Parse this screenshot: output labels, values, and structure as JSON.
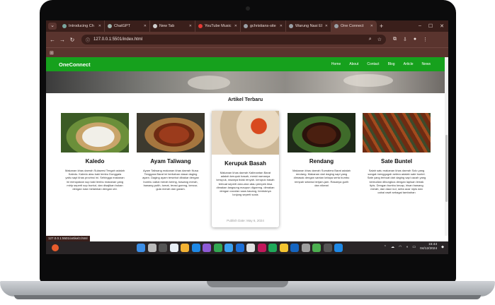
{
  "browser": {
    "tabs": [
      {
        "title": "Introducing Ch",
        "active": false,
        "favicon_color": "#7aa7a0"
      },
      {
        "title": "ChatGPT",
        "active": false,
        "favicon_color": "#9fb3ad"
      },
      {
        "title": "New Tab",
        "active": false,
        "favicon_color": "#cfcfcf"
      },
      {
        "title": "YouTube Music",
        "active": false,
        "favicon_color": "#e53935"
      },
      {
        "title": "gchristians-site",
        "active": false,
        "favicon_color": "#9aa0a6"
      },
      {
        "title": "Warung Nasi El",
        "active": false,
        "favicon_color": "#9aa0a6"
      },
      {
        "title": "One Connect",
        "active": true,
        "favicon_color": "#9aa0a6"
      }
    ],
    "url": "127.0.0.1:5501/index.html",
    "status_url": "127.0.0.1:5501/artikel3.html"
  },
  "site": {
    "brand": "OneConnect",
    "menu": [
      "Home",
      "About",
      "Contact",
      "Blog",
      "Article",
      "News"
    ],
    "section_title": "Artikel Terbaru",
    "cards": [
      {
        "title": "Kaledo",
        "text": "Makanan khas daerah Sulawesi Tengah adalah Kaledo. Kaledo atau kaki lembu Donggala yaitu sapi khas provinsi ini. Sehingga makanan ini merupakan sup kaki lembu makanan yang mirip seperti sop buntut, dan disajikan bukan dengan nasi melainkan dengan ubi."
      },
      {
        "title": "Ayam Taliwang",
        "text": "Ayam Taliwang makanan khas daerah Nusa Tenggara Barat ini berbahan dasar daging ayam. Daging ayam tersebut dibakar dengan bumbu cabai merah kering, bawang merah, bawang putih, tomat, terasi goreng, kencur, gula merah dan garam."
      },
      {
        "title": "Kerupuk Basah",
        "text": "Makanan khas daerah Kalimantan Barat adalah kerupuk basah, meski namanya kerupuk, rasanya tidak renyah. kerupuk basah terbuat seperti olan-olan atau pempek bisa dimakan langsung maupun digoreng. dimakan dengan cocolan saus kacang, bentuknya lonjong seperti sosis",
        "date": "Publish Date: May 6, 2024"
      },
      {
        "title": "Rendang",
        "text": "Makanan khas daerah Sumatera Barat adalah rendang. Makanan dari daging sapi yang dimasak dengan santan kelapa serta bumbu rempah selama berjam-jam. Rasanya gurih dan nikmat"
      },
      {
        "title": "Sate Buntel",
        "text": "Salah satu makanan khas daerah Solo yang sangat menggugah selera adalah sate buntel. Sate yang terbuat dari daging sapi cacah yang kemudian dibungkus dengan lapisan lemak tipis. Dengan bumbu kecap, irisan bawang merah, dan daun kol, serta acar nipis dan cabai rawit sebagai tambahan"
      }
    ]
  },
  "taskbar": {
    "time": "15:44",
    "date": "04/12/2024",
    "icon_colors": [
      "#3c8ee6",
      "#bbbbbb",
      "#555555",
      "#e8eef5",
      "#f2b233",
      "#1e88e5",
      "#8e5ad6",
      "#33a853",
      "#3aa0f0",
      "#1d6fd6",
      "#e0e0e0",
      "#c2185b",
      "#1faa5a",
      "#f4c430",
      "#1565c0",
      "#9e9e9e",
      "#4caf50",
      "#555555",
      "#1e88e5"
    ]
  }
}
